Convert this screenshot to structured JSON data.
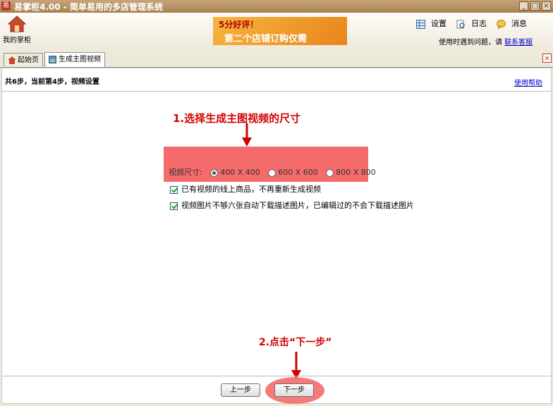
{
  "window": {
    "title": "易掌柜4.00 - 简单易用的多店管理系统",
    "app_icon_text": "易",
    "min_label": "_",
    "max_label": "□",
    "close_label": "×"
  },
  "toolbar": {
    "home_label": "我的掌柜",
    "banner_line1": "5分好评！",
    "banner_line2": "第二个店铺订购仅需",
    "settings_label": "设置",
    "log_label": "日志",
    "message_label": "消息",
    "help_prefix": "使用时遇到问题，请",
    "contact_label": "联系客服"
  },
  "tabs": [
    {
      "label": "起始页",
      "icon": "home-icon"
    },
    {
      "label": "生成主图视频",
      "icon": "video-icon"
    }
  ],
  "tab_close_label": "×",
  "main": {
    "step_info": "共6步，当前第4步，视频设置",
    "help_link": "使用帮助",
    "annotation1": "1.选择生成主图视频的尺寸",
    "annotation2": "2.点击“下一步”",
    "size_label": "视频尺寸:",
    "size_options": [
      {
        "label": "400 X 400",
        "selected": true
      },
      {
        "label": "600 X 600",
        "selected": false
      },
      {
        "label": "800 X 800",
        "selected": false
      }
    ],
    "checkboxes": [
      {
        "label": "已有视频的线上商品，不再重新生成视频",
        "checked": true
      },
      {
        "label": "视频图片不够六张自动下载描述图片，已编辑过的不会下载描述图片",
        "checked": true
      }
    ],
    "prev_button": "上一步",
    "next_button": "下一步"
  },
  "colors": {
    "annotation": "#d10000",
    "highlight": "#f45e5e",
    "titlebar": "#b28a58"
  }
}
